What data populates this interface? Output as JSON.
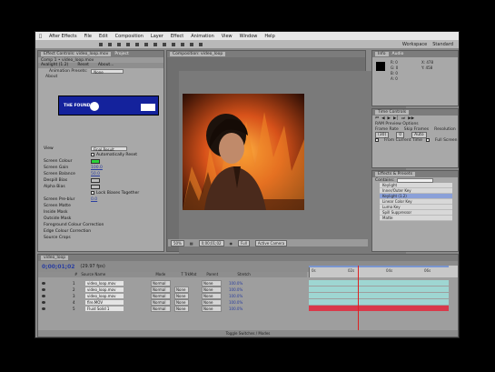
{
  "menubar": {
    "app": "After Effects",
    "items": [
      "File",
      "Edit",
      "Composition",
      "Layer",
      "Effect",
      "Animation",
      "View",
      "Window",
      "Help"
    ]
  },
  "toolbar": {
    "workspace_label": "Workspace",
    "workspace_value": "Standard"
  },
  "effect_controls": {
    "tabs": [
      "Effect Controls: video_loop.mov",
      "Project"
    ],
    "subtitle": "Comp 1 • video_loop.mov",
    "effect_name": "Avalight (1.2)",
    "reset_label": "Reset",
    "about_label": "About...",
    "animation_presets_label": "Animation Presets:",
    "animation_presets_value": "None",
    "logo_text": "THE FOUNDRY",
    "section_about": "About",
    "params": [
      {
        "name": "View",
        "value": "Final Result"
      },
      {
        "name": "",
        "value": "Automatically Reset"
      },
      {
        "name": "Screen Colour",
        "value": ""
      },
      {
        "name": "Screen Gain",
        "value": "100.0"
      },
      {
        "name": "Screen Balance",
        "value": "50.0"
      },
      {
        "name": "Despill Bias",
        "value": ""
      },
      {
        "name": "Alpha Bias",
        "value": ""
      },
      {
        "name": "",
        "value": "Lock Biases Together"
      },
      {
        "name": "Screen Pre-blur",
        "value": "0.0"
      },
      {
        "name": "Screen Matte",
        "value": ""
      },
      {
        "name": "Inside Mask",
        "value": ""
      },
      {
        "name": "Outside Mask",
        "value": ""
      },
      {
        "name": "Foreground Colour Correction",
        "value": ""
      },
      {
        "name": "Edge Colour Correction",
        "value": ""
      },
      {
        "name": "Source Crops",
        "value": ""
      }
    ]
  },
  "composition": {
    "tab": "Composition: video_loop",
    "zoom": "50%",
    "timecode": "0;00;01;02",
    "view_mode": "Full",
    "camera": "Active Camera"
  },
  "info_panel": {
    "tabs": [
      "Info",
      "Audio"
    ],
    "values": [
      "R: 0",
      "G: 0",
      "B: 0",
      "A: 0",
      "X: 478",
      "Y: 458"
    ]
  },
  "time_controls": {
    "tab": "Time Controls",
    "ram_preview": "RAM Preview Options",
    "frame_rate_label": "Frame Rate",
    "skip_label": "Skip Frames",
    "resolution_label": "Resolution",
    "frame_rate": "(30)",
    "skip": "0",
    "resolution": "Auto",
    "from_current": "From Current Time",
    "full_screen": "Full Screen"
  },
  "effects_presets": {
    "tab": "Effects & Presets",
    "search": "Contains:",
    "items": [
      "Keylight",
      "Inner/Outer Key",
      "Keylight (1.2)",
      "Linear Color Key",
      "Luma Key",
      "Spill Suppressor",
      "Matte"
    ]
  },
  "timeline": {
    "tab": "video_loop",
    "timecode": "0;00;01;02",
    "fps": "(29.97 fps)",
    "columns": [
      "#",
      "Source Name",
      "Mode",
      "T TrkMat",
      "Parent",
      "Stretch"
    ],
    "layers": [
      {
        "num": "1",
        "name": "video_loop.mov",
        "mode": "Normal",
        "trkmat": "",
        "parent": "None",
        "stretch": "100.0%",
        "color": "#9ed6d2"
      },
      {
        "num": "2",
        "name": "video_loop.mov",
        "mode": "Normal",
        "trkmat": "None",
        "parent": "None",
        "stretch": "100.0%",
        "color": "#9ed6d2"
      },
      {
        "num": "3",
        "name": "video_loop.mov",
        "mode": "Normal",
        "trkmat": "None",
        "parent": "None",
        "stretch": "100.0%",
        "color": "#9ed6d2"
      },
      {
        "num": "4",
        "name": "fire.MOV",
        "mode": "Normal",
        "trkmat": "None",
        "parent": "None",
        "stretch": "100.0%",
        "color": "#9ed6d2"
      },
      {
        "num": "5",
        "name": "Fluid Solid 1",
        "mode": "Normal",
        "trkmat": "None",
        "parent": "None",
        "stretch": "100.0%",
        "color": "#d83a4a"
      }
    ],
    "ruler_ticks": [
      "0s",
      "02s",
      "04s",
      "06s"
    ],
    "footer": "Toggle Switches / Modes"
  }
}
